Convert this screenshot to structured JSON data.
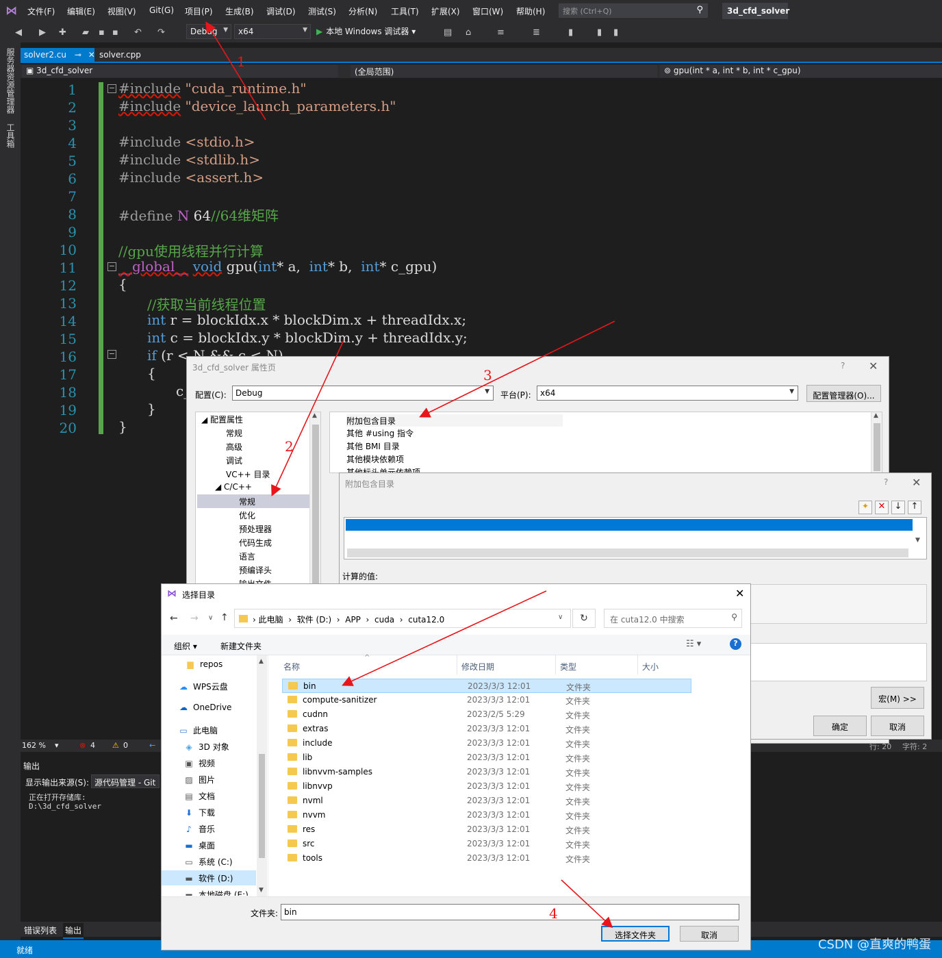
{
  "menubar": {
    "items": [
      "文件(F)",
      "编辑(E)",
      "视图(V)",
      "Git(G)",
      "项目(P)",
      "生成(B)",
      "调试(D)",
      "测试(S)",
      "分析(N)",
      "工具(T)",
      "扩展(X)",
      "窗口(W)",
      "帮助(H)"
    ],
    "search_placeholder": "搜索 (Ctrl+Q)",
    "solution_name": "3d_cfd_solver"
  },
  "toolbar": {
    "config": "Debug",
    "platform": "x64",
    "run_label": "本地 Windows 调试器"
  },
  "side_panel": {
    "server_explorer": "服务器资源管理器",
    "toolbox": "工具箱"
  },
  "tabs": [
    {
      "label": "solver2.cu",
      "pin": "⊸",
      "close": "✕"
    },
    {
      "label": "solver.cpp"
    }
  ],
  "navbar": {
    "project": "3d_cfd_solver",
    "scope": "(全局范围)",
    "member": "gpu(int * a, int * b, int * c_gpu)"
  },
  "editor": {
    "line_numbers": [
      "1",
      "2",
      "3",
      "4",
      "5",
      "6",
      "7",
      "8",
      "9",
      "10",
      "11",
      "12",
      "13",
      "14",
      "15",
      "16",
      "17",
      "18",
      "19",
      "20"
    ],
    "inc1_kw": "#include",
    "inc1_file": "\"cuda_runtime.h\"",
    "inc2_kw": "#include",
    "inc2_file": "\"device_launch_parameters.h\"",
    "inc3_kw": "#include",
    "inc3_file": "<stdio.h>",
    "inc4_kw": "#include",
    "inc4_file": "<stdlib.h>",
    "inc5_kw": "#include",
    "inc5_file": "<assert.h>",
    "def_kw": "#define",
    "def_name": "N",
    "def_val": " 64",
    "def_comment": "//64维矩阵",
    "comment1": "//gpu使用线程并行计算",
    "fn_global": "__global__",
    "fn_void": "void",
    "fn_sig": " gpu(",
    "fn_int1": "int",
    "fn_p1": "* a,  ",
    "fn_int2": "int",
    "fn_p2": "* b,  ",
    "fn_int3": "int",
    "fn_p3": "* c_gpu)",
    "brace_open": "{",
    "comment2": "//获取当前线程位置",
    "line14_kw": "int",
    "line14_rest": " r = blockIdx.x * blockDim.x + threadIdx.x;",
    "line15_kw": "int",
    "line15_rest": " c = blockIdx.y * blockDim.y + threadIdx.y;",
    "line16_kw": "if",
    "line16_rest": " (r < N && c < N)",
    "line17": "{",
    "line18": "c_",
    "line19": "}",
    "line20": "}"
  },
  "editor_status": {
    "zoom": "162 %",
    "errors": "4",
    "warnings": "0",
    "position": "行: 20",
    "char": "字符: 2"
  },
  "output": {
    "title": "输出",
    "source_label": "显示输出来源(S):",
    "source_value": "源代码管理 - Git",
    "lines": [
      "正在打开存储库:",
      "D:\\3d_cfd_solver"
    ]
  },
  "bottom_tabs": [
    "错误列表",
    "输出"
  ],
  "statusbar": {
    "text": "就绪"
  },
  "prop_dialog": {
    "title": "3d_cfd_solver 属性页",
    "help": "?",
    "close": "✕",
    "config_label": "配置(C):",
    "config_value": "Debug",
    "platform_label": "平台(P):",
    "platform_value": "x64",
    "config_mgr": "配置管理器(O)...",
    "tree": [
      "配置属性",
      "常规",
      "高级",
      "调试",
      "VC++ 目录",
      "C/C++",
      "常规",
      "优化",
      "预处理器",
      "代码生成",
      "语言",
      "预编译头",
      "输出文件"
    ],
    "props": [
      "附加包含目录",
      "其他 #using 指令",
      "其他 BMI 目录",
      "其他模块依赖项",
      "其他标头单元依赖项"
    ]
  },
  "inc_dialog": {
    "title": "附加包含目录",
    "help": "?",
    "close": "✕",
    "computed_label": "计算的值:",
    "macro_btn": "宏(M) >>",
    "ok": "确定",
    "cancel": "取消"
  },
  "file_dialog": {
    "title": "选择目录",
    "close": "✕",
    "breadcrumb": [
      "此电脑",
      "软件 (D:)",
      "APP",
      "cuda",
      "cuta12.0"
    ],
    "search_placeholder": "在 cuta12.0 中搜索",
    "organize": "组织 ▾",
    "new_folder": "新建文件夹",
    "columns": [
      "名称",
      "修改日期",
      "类型",
      "大小"
    ],
    "side": [
      "repos",
      "WPS云盘",
      "OneDrive",
      "此电脑",
      "3D 对象",
      "视频",
      "图片",
      "文档",
      "下载",
      "音乐",
      "桌面",
      "系统 (C:)",
      "软件 (D:)",
      "本地磁盘 (E:)"
    ],
    "rows": [
      {
        "name": "bin",
        "date": "2023/3/3 12:01",
        "type": "文件夹"
      },
      {
        "name": "compute-sanitizer",
        "date": "2023/3/3 12:01",
        "type": "文件夹"
      },
      {
        "name": "cudnn",
        "date": "2023/2/5 5:29",
        "type": "文件夹"
      },
      {
        "name": "extras",
        "date": "2023/3/3 12:01",
        "type": "文件夹"
      },
      {
        "name": "include",
        "date": "2023/3/3 12:01",
        "type": "文件夹"
      },
      {
        "name": "lib",
        "date": "2023/3/3 12:01",
        "type": "文件夹"
      },
      {
        "name": "libnvvm-samples",
        "date": "2023/3/3 12:01",
        "type": "文件夹"
      },
      {
        "name": "libnvvp",
        "date": "2023/3/3 12:01",
        "type": "文件夹"
      },
      {
        "name": "nvml",
        "date": "2023/3/3 12:01",
        "type": "文件夹"
      },
      {
        "name": "nvvm",
        "date": "2023/3/3 12:01",
        "type": "文件夹"
      },
      {
        "name": "res",
        "date": "2023/3/3 12:01",
        "type": "文件夹"
      },
      {
        "name": "src",
        "date": "2023/3/3 12:01",
        "type": "文件夹"
      },
      {
        "name": "tools",
        "date": "2023/3/3 12:01",
        "type": "文件夹"
      }
    ],
    "folder_label": "文件夹:",
    "folder_value": "bin",
    "select_btn": "选择文件夹",
    "cancel_btn": "取消"
  },
  "annotations": [
    "1",
    "2",
    "3",
    "4"
  ],
  "watermark": "CSDN @直爽的鸭蛋",
  "colors": {
    "accent": "#007acc",
    "arrow": "#e8161b",
    "selection": "#cce8ff"
  }
}
